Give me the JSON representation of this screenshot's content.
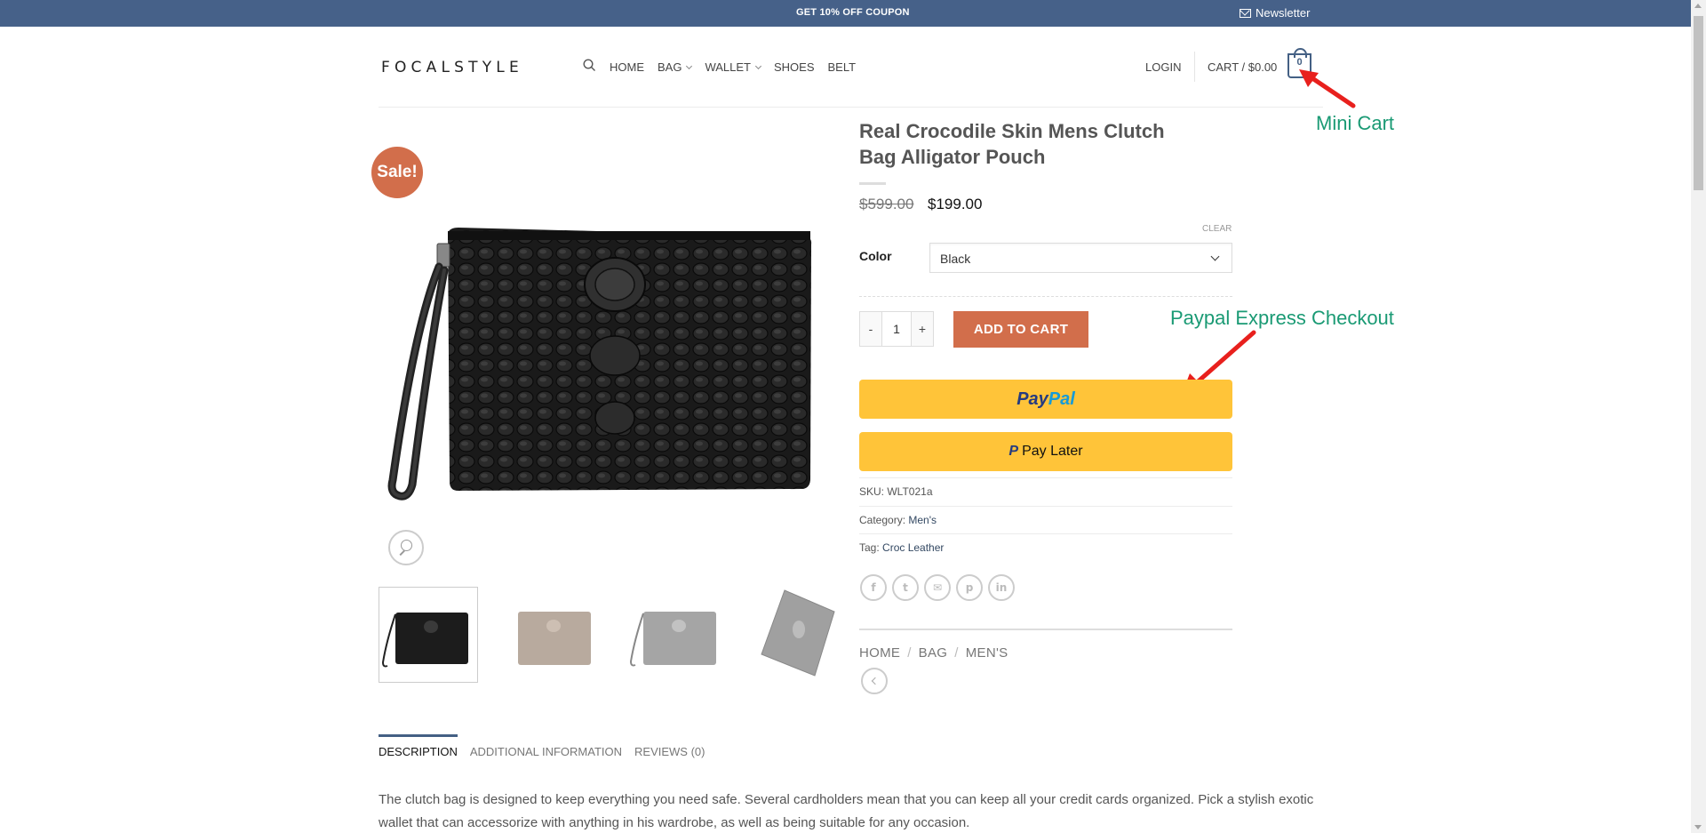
{
  "topbar": {
    "coupon": "GET 10% OFF COUPON",
    "newsletter": "Newsletter"
  },
  "header": {
    "logo": "FOCALSTYLE",
    "nav": [
      {
        "label": "HOME",
        "dropdown": false
      },
      {
        "label": "BAG",
        "dropdown": true
      },
      {
        "label": "WALLET",
        "dropdown": true
      },
      {
        "label": "SHOES",
        "dropdown": false
      },
      {
        "label": "BELT",
        "dropdown": false
      }
    ],
    "login": "LOGIN",
    "cart_label": "CART / $0.00",
    "cart_count": "0"
  },
  "annotations": {
    "mini_cart": "Mini Cart",
    "paypal": "Paypal Express Checkout",
    "color": "#1a9a74",
    "arrow_color": "#e8201d"
  },
  "gallery": {
    "sale_badge": "Sale!",
    "thumbnails": [
      "black-clutch",
      "gold-clutch",
      "silver-clutch",
      "silver-wallet"
    ],
    "active_thumbnail": 0
  },
  "product": {
    "title": "Real Crocodile Skin Mens Clutch Bag Alligator Pouch",
    "price_old": "$599.00",
    "price_new": "$199.00",
    "clear": "CLEAR",
    "color_label": "Color",
    "color_value": "Black",
    "quantity": "1",
    "qty_minus": "-",
    "qty_plus": "+",
    "add_to_cart": "ADD TO CART",
    "paypal_pay": "Pay",
    "paypal_pal": "Pal",
    "pay_later": "Pay Later",
    "sku_label": "SKU:",
    "sku": "WLT021a",
    "category_label": "Category:",
    "category": "Men's",
    "tag_label": "Tag:",
    "tag": "Croc Leather",
    "accent_color": "#d26e4b",
    "paypal_color": "#ffc439"
  },
  "social": [
    "f",
    "t",
    "✉",
    "p",
    "in"
  ],
  "breadcrumb": [
    "HOME",
    "BAG",
    "MEN'S"
  ],
  "tabs": [
    {
      "label": "DESCRIPTION",
      "active": true
    },
    {
      "label": "ADDITIONAL INFORMATION",
      "active": false
    },
    {
      "label": "REVIEWS (0)",
      "active": false
    }
  ],
  "description": "The clutch bag is designed to keep everything you need safe. Several cardholders mean that you can keep all your credit cards organized. Pick a stylish exotic wallet that can accessorize with anything in his wardrobe, as well as being suitable for any occasion."
}
